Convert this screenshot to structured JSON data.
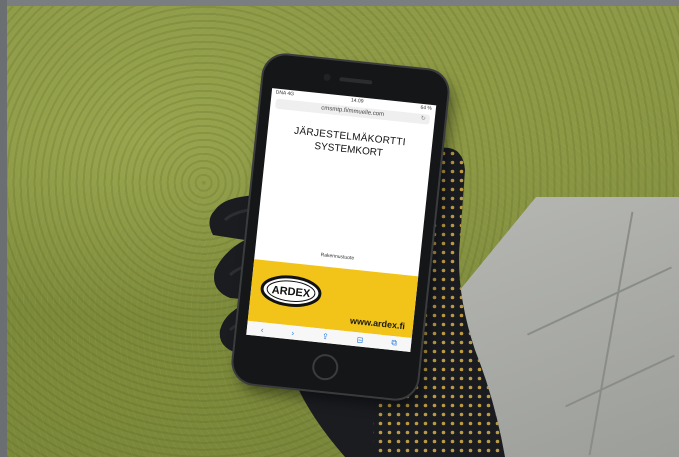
{
  "photo": {
    "description_colors": {
      "grass": "#8d9a48",
      "pavement": "#b0b1ad",
      "glove": "#1a1c20",
      "glove_dots": "#d8b24a"
    }
  },
  "phone": {
    "status_bar": {
      "carrier": "DNA 4G",
      "time": "14.09",
      "battery": "64 %"
    },
    "url": "cmsmtp.fi/mmuelle.com",
    "page": {
      "title": "JÄRJESTELMÄKORTTI",
      "subtitle": "SYSTEMKORT",
      "small_label": "Rakennustuote",
      "brand_logo_text": "ARDEX",
      "brand_url": "www.ardex.fi",
      "brand_color": "#f2c419"
    },
    "toolbar_icons": [
      "back-icon",
      "forward-icon",
      "share-icon",
      "bookmarks-icon",
      "tabs-icon"
    ],
    "toolbar_glyphs": [
      "‹",
      "›",
      "⇪",
      "⊟",
      "⧉"
    ]
  }
}
